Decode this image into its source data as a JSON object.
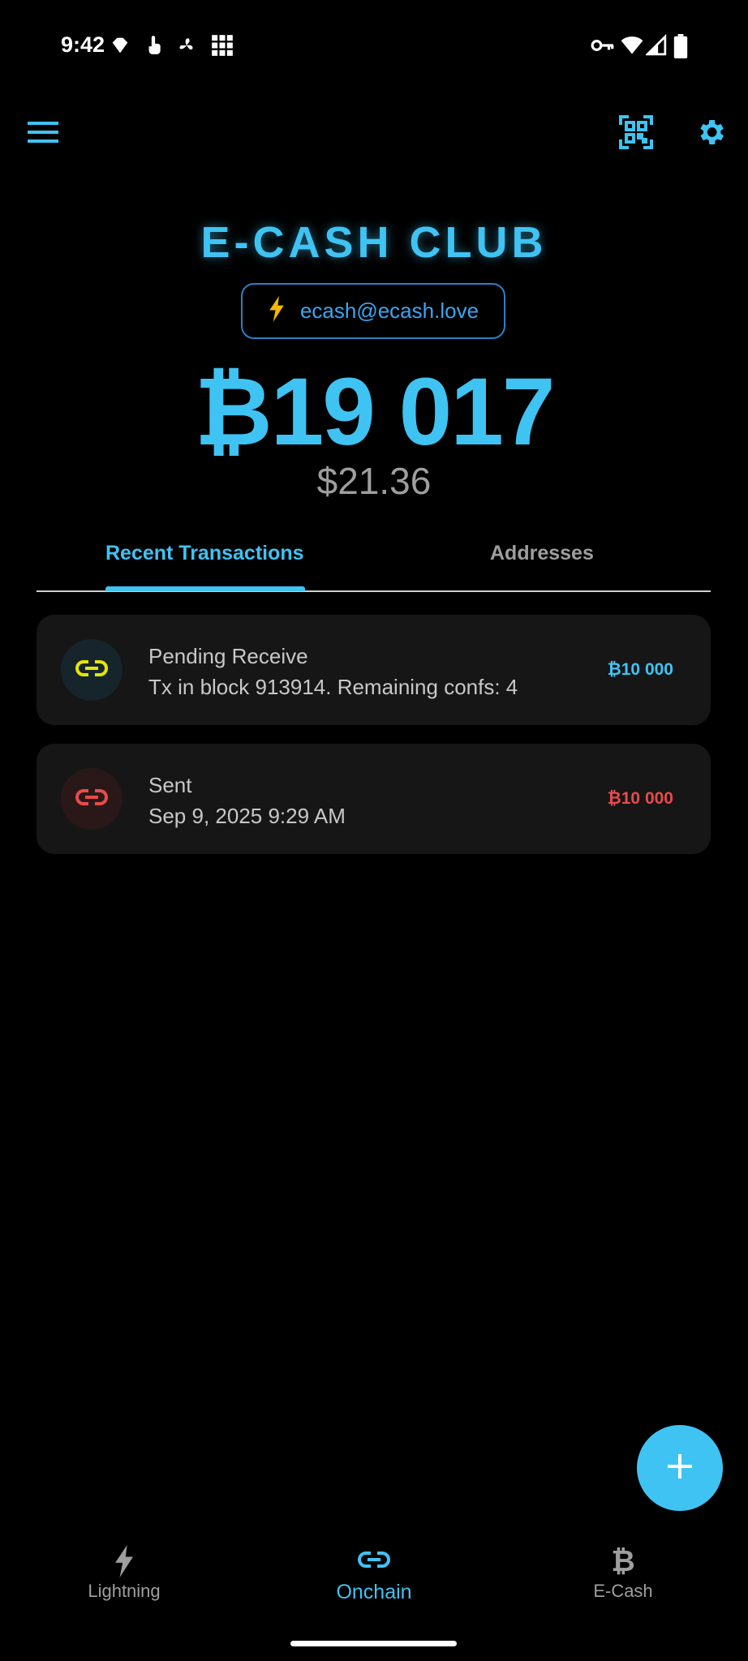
{
  "status_bar": {
    "time": "9:42",
    "left_icons": [
      "diamond-icon",
      "touch-icon",
      "fan-icon",
      "grid-icon"
    ],
    "right_icons": [
      "vpn-key-icon",
      "wifi-icon",
      "signal-icon",
      "battery-icon"
    ]
  },
  "app_bar": {
    "menu_icon": "hamburger-menu-icon",
    "qr_icon": "qr-scan-icon",
    "settings_icon": "gear-icon"
  },
  "header": {
    "title": "E-CASH CLUB",
    "address_icon": "lightning-bolt-icon",
    "address": "ecash@ecash.love",
    "balance": "₿19 017",
    "fiat_balance": "$21.36"
  },
  "tabs": [
    {
      "label": "Recent Transactions",
      "active": true
    },
    {
      "label": "Addresses",
      "active": false
    }
  ],
  "transactions": [
    {
      "title": "Pending Receive",
      "subtitle": "Tx in block 913914. Remaining confs: 4",
      "amount": "₿10 000",
      "icon": "link-icon",
      "icon_color": "#e6e600",
      "amount_color": "#3fc3f3"
    },
    {
      "title": "Sent",
      "subtitle": "Sep 9, 2025 9:29 AM",
      "amount": "₿10 000",
      "icon": "link-icon",
      "icon_color": "#e84b4b",
      "amount_color": "#e84b4b"
    }
  ],
  "fab": {
    "icon": "plus-icon"
  },
  "bottom_nav": [
    {
      "label": "Lightning",
      "icon": "lightning-bolt-icon",
      "active": false
    },
    {
      "label": "Onchain",
      "icon": "link-icon",
      "active": true
    },
    {
      "label": "E-Cash",
      "icon": "bitcoin-icon",
      "active": false
    }
  ],
  "colors": {
    "accent": "#3fc3f3",
    "background": "#000000",
    "card": "#161616",
    "pending": "#e6e600",
    "sent": "#e84b4b",
    "muted": "#9e9e9e"
  }
}
